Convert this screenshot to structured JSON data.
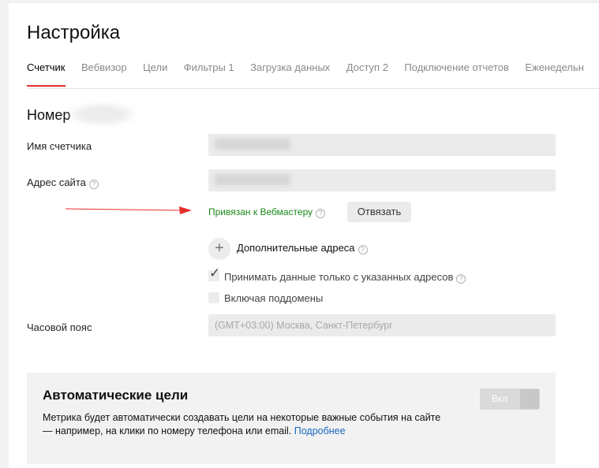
{
  "page": {
    "title": "Настройка"
  },
  "tabs": [
    {
      "label": "Счетчик",
      "count": ""
    },
    {
      "label": "Вебвизор",
      "count": ""
    },
    {
      "label": "Цели",
      "count": ""
    },
    {
      "label": "Фильтры",
      "count": "1"
    },
    {
      "label": "Загрузка данных",
      "count": ""
    },
    {
      "label": "Доступ",
      "count": "2"
    },
    {
      "label": "Подключение отчетов",
      "count": ""
    },
    {
      "label": "Еженедельн",
      "count": ""
    }
  ],
  "counter": {
    "number_label": "Номер"
  },
  "form": {
    "name_label": "Имя счетчика",
    "site_label": "Адрес сайта",
    "webmaster_status": "Привязан к Вебмастеру",
    "unlink_label": "Отвязать",
    "add_addresses_label": "Дополнительные адреса",
    "only_listed_label": "Принимать данные только с указанных адресов",
    "only_listed_checked": true,
    "subdomains_label": "Включая поддомены",
    "subdomains_checked": false,
    "timezone_label": "Часовой пояс",
    "timezone_value": "(GMT+03:00) Москва, Санкт-Петербург"
  },
  "auto_goals": {
    "title": "Автоматические цели",
    "description": "Метрика будет автоматически создавать цели на некоторые важные события на сайте — например, на клики по номеру телефона или email.",
    "more_link": "Подробнее",
    "toggle_label": "Вкл",
    "toggle_on": false
  },
  "colors": {
    "accent_red": "#e52e2e",
    "linked_green": "#1a8a1a",
    "link_blue": "#1565c0"
  }
}
